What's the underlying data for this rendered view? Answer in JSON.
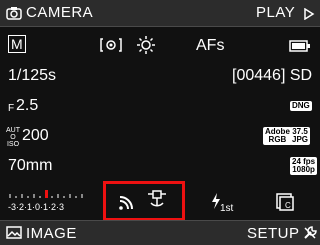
{
  "top": {
    "left_label": "CAMERA",
    "right_label": "PLAY"
  },
  "row1": {
    "mode_letter": "M",
    "af_label": "AFs",
    "icons": [
      "metering-icon",
      "white-balance-sun-icon",
      "battery-icon"
    ]
  },
  "row2": {
    "shutter": "1/125s",
    "counter": "[00446] SD"
  },
  "row3": {
    "aperture": "2.5",
    "aperture_prefix": "F",
    "file_badge": "DNG"
  },
  "row4": {
    "iso_prefix": "AUTO ISO",
    "iso": "200",
    "adobe_top": "Adobe",
    "adobe_bottom": "RGB",
    "res_top": "37.5",
    "res_bottom": "JPG"
  },
  "row5": {
    "focal": "70mm",
    "video_top": "24 fps",
    "video_bottom": "1080p"
  },
  "bottom_icons": {
    "exposure_scale": "-3·2·1·0·1·2·3",
    "wifi": "wifi-icon",
    "gps": "gps-icon",
    "flash": "flash-icon",
    "flash_sub": "1st",
    "card": "card-icon",
    "card_label": "C"
  },
  "footer": {
    "left_label": "IMAGE",
    "right_label": "SETUP"
  },
  "colors": {
    "highlight": "#e11"
  }
}
